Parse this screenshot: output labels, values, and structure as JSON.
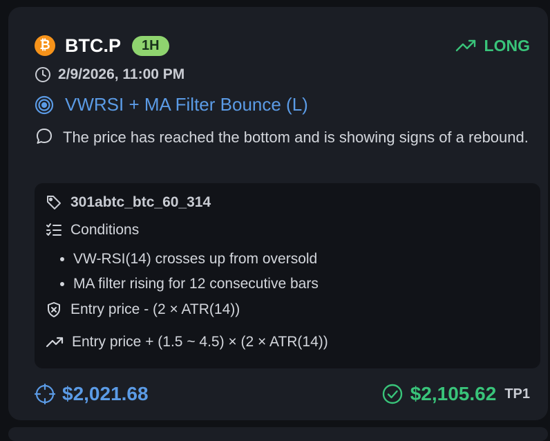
{
  "signal": {
    "coin_icon": "bitcoin-icon",
    "coin_glyph": "₿",
    "symbol": "BTC.P",
    "timeframe": "1H",
    "direction": "LONG",
    "datetime": "2/9/2026, 11:00 PM",
    "strategy": "VWRSI + MA Filter Bounce (L)",
    "message": "The price has reached the bottom and is showing signs of a rebound."
  },
  "details": {
    "tag": "301abtc_btc_60_314",
    "conditions_label": "Conditions",
    "conditions": [
      "VW-RSI(14) crosses up from oversold",
      "MA filter rising for 12 consecutive bars"
    ],
    "stop_loss": "Entry price - (2 × ATR(14))",
    "take_profit": "Entry price + (1.5 ~ 4.5) × (2 × ATR(14))"
  },
  "prices": {
    "entry": "$2,021.68",
    "target": "$2,105.62",
    "target_label": "TP1"
  },
  "colors": {
    "accent_blue": "#5b9be6",
    "long_green": "#39c47a",
    "timeframe_badge": "#8fd46f",
    "bitcoin_orange": "#f7931a",
    "card_bg": "#1b1e25"
  },
  "icons": [
    "bitcoin-icon",
    "trend-up-icon",
    "clock-icon",
    "target-icon",
    "message-icon",
    "tag-icon",
    "checklist-icon",
    "shield-x-icon",
    "crosshair-icon",
    "check-circle-icon"
  ]
}
